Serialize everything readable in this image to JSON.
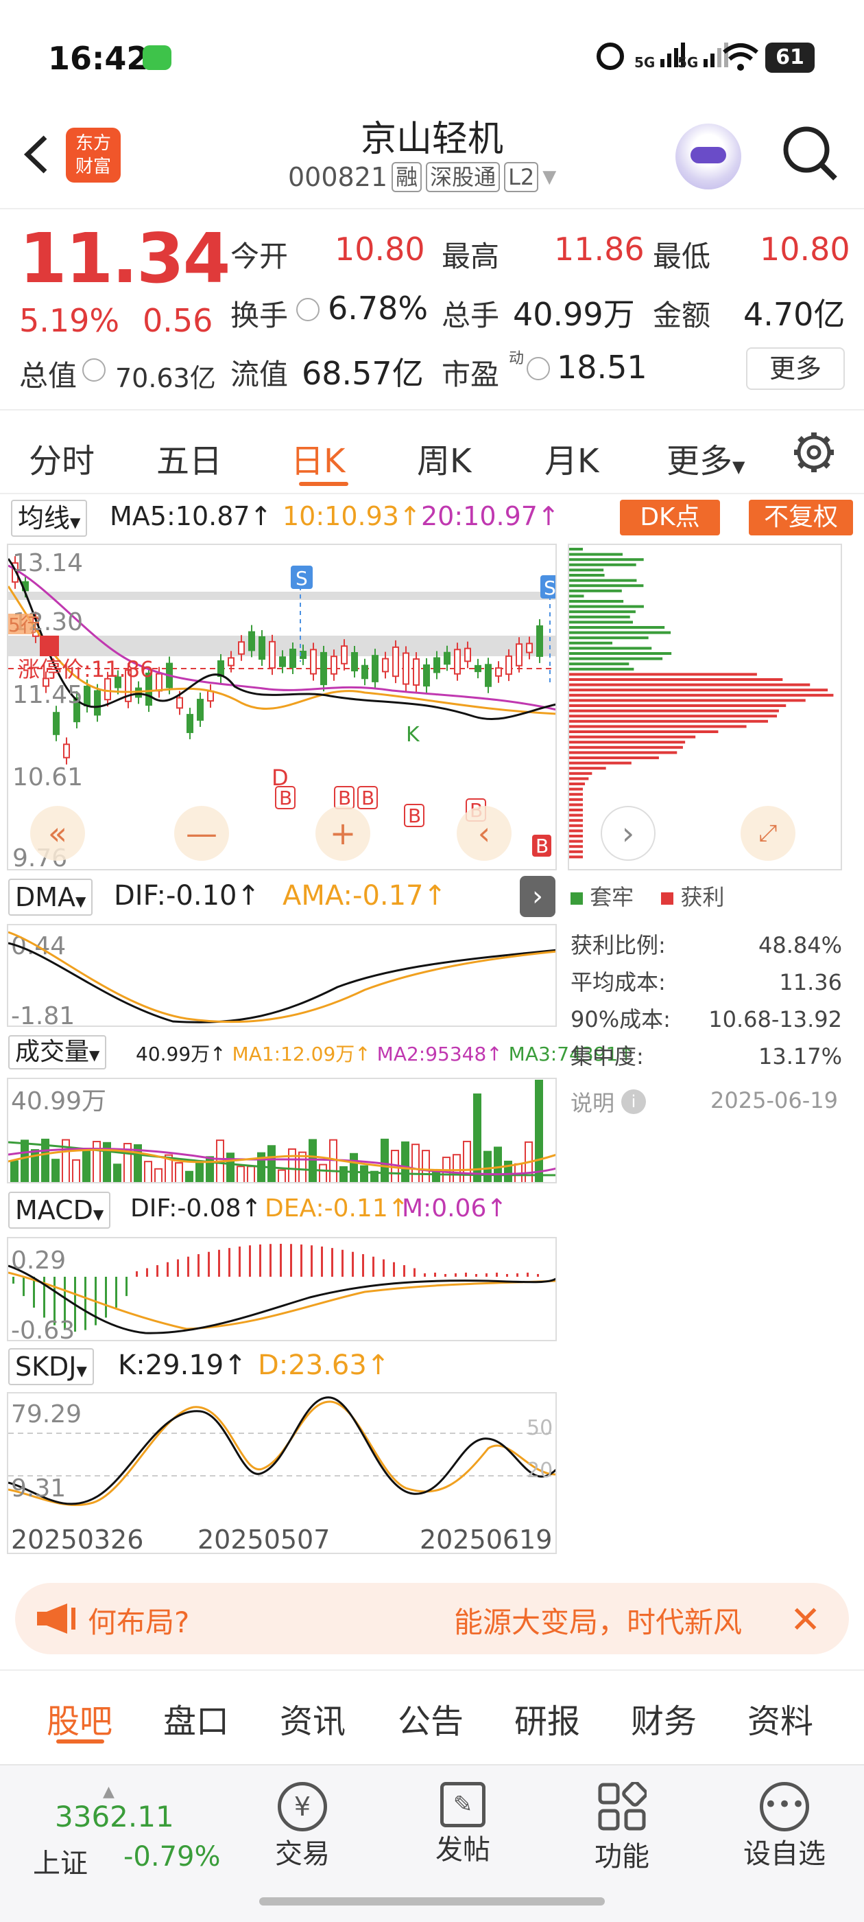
{
  "status_bar": {
    "time": "16:42",
    "network1": "5G",
    "network2": "5G",
    "battery": "61"
  },
  "header": {
    "logo": "东方\n财富",
    "title": "京山轻机",
    "code": "000821",
    "tags": [
      "融",
      "深股通",
      "L2"
    ]
  },
  "quote": {
    "price": "11.34",
    "change_pct": "5.19%",
    "change": "0.56",
    "open_label": "今开",
    "open": "10.80",
    "high_label": "最高",
    "high": "11.86",
    "low_label": "最低",
    "low": "10.80",
    "turnover_label": "换手",
    "turnover": "6.78%",
    "volume_label": "总手",
    "volume": "40.99万",
    "amount_label": "金额",
    "amount": "4.70亿",
    "mktcap_label": "总值",
    "mktcap": "70.63亿",
    "float_label": "流值",
    "float": "68.57亿",
    "pe_label": "市盈",
    "pe_sup": "动",
    "pe": "18.51",
    "more_button": "更多"
  },
  "period_tabs": [
    "分时",
    "五日",
    "日K",
    "周K",
    "月K",
    "更多"
  ],
  "active_tab": "日K",
  "ma_bar": {
    "select": "均线",
    "ma5": "MA5:10.87",
    "ma10": "10:10.93",
    "ma20": "20:10.97",
    "dk_button": "DK点",
    "fq_button": "不复权"
  },
  "kline": {
    "y_labels": [
      "13.14",
      "12.30",
      "11.45",
      "10.61",
      "9.76"
    ],
    "limit_label": "涨停价:11.86",
    "left_marker": "5行",
    "s_marker": "S",
    "b_marker": "B",
    "d_marker": "D",
    "k_marker": "K"
  },
  "dma": {
    "select": "DMA",
    "dif": "DIF:-0.10",
    "ama": "AMA:-0.17",
    "y_top": "0.44",
    "y_bottom": "-1.81"
  },
  "vol": {
    "select": "成交量",
    "vol": "40.99万",
    "ma1": "MA1:12.09万",
    "ma2": "MA2:95348",
    "ma3": "MA3:74391",
    "y_top": "40.99万"
  },
  "macd": {
    "select": "MACD",
    "dif": "DIF:-0.08",
    "dea": "DEA:-0.11",
    "m": "M:0.06",
    "y_top": "0.29",
    "y_bottom": "-0.63"
  },
  "skdj": {
    "select": "SKDJ",
    "k": "K:29.19",
    "d": "D:23.63",
    "y_top": "79.29",
    "y_bottom": "9.31",
    "r50": "50",
    "r20": "20"
  },
  "dates": [
    "20250326",
    "20250507",
    "20250619"
  ],
  "chips": {
    "legend_trapped": "套牢",
    "legend_profit": "获利",
    "rows": [
      {
        "label": "获利比例:",
        "value": "48.84%"
      },
      {
        "label": "平均成本:",
        "value": "11.36"
      },
      {
        "label": "90%成本:",
        "value": "10.68-13.92"
      },
      {
        "label": "集中度:",
        "value": "13.17%"
      }
    ],
    "note": "说明",
    "date": "2025-06-19"
  },
  "banner": {
    "left_text": "何布局?",
    "right_text": "能源大变局，时代新风"
  },
  "bottom_tabs": [
    "股吧",
    "盘口",
    "资讯",
    "公告",
    "研报",
    "财务",
    "资料"
  ],
  "bottom_nav": {
    "index_value": "3362.11",
    "index_name": "上证",
    "index_change": "-0.79%",
    "items": [
      "交易",
      "发帖",
      "功能",
      "设自选"
    ]
  },
  "colors": {
    "up": "#e03a3a",
    "down": "#3a9d3a",
    "ma10": "#f0a01f",
    "ma20": "#c038b0",
    "accent": "#f06a2a"
  }
}
